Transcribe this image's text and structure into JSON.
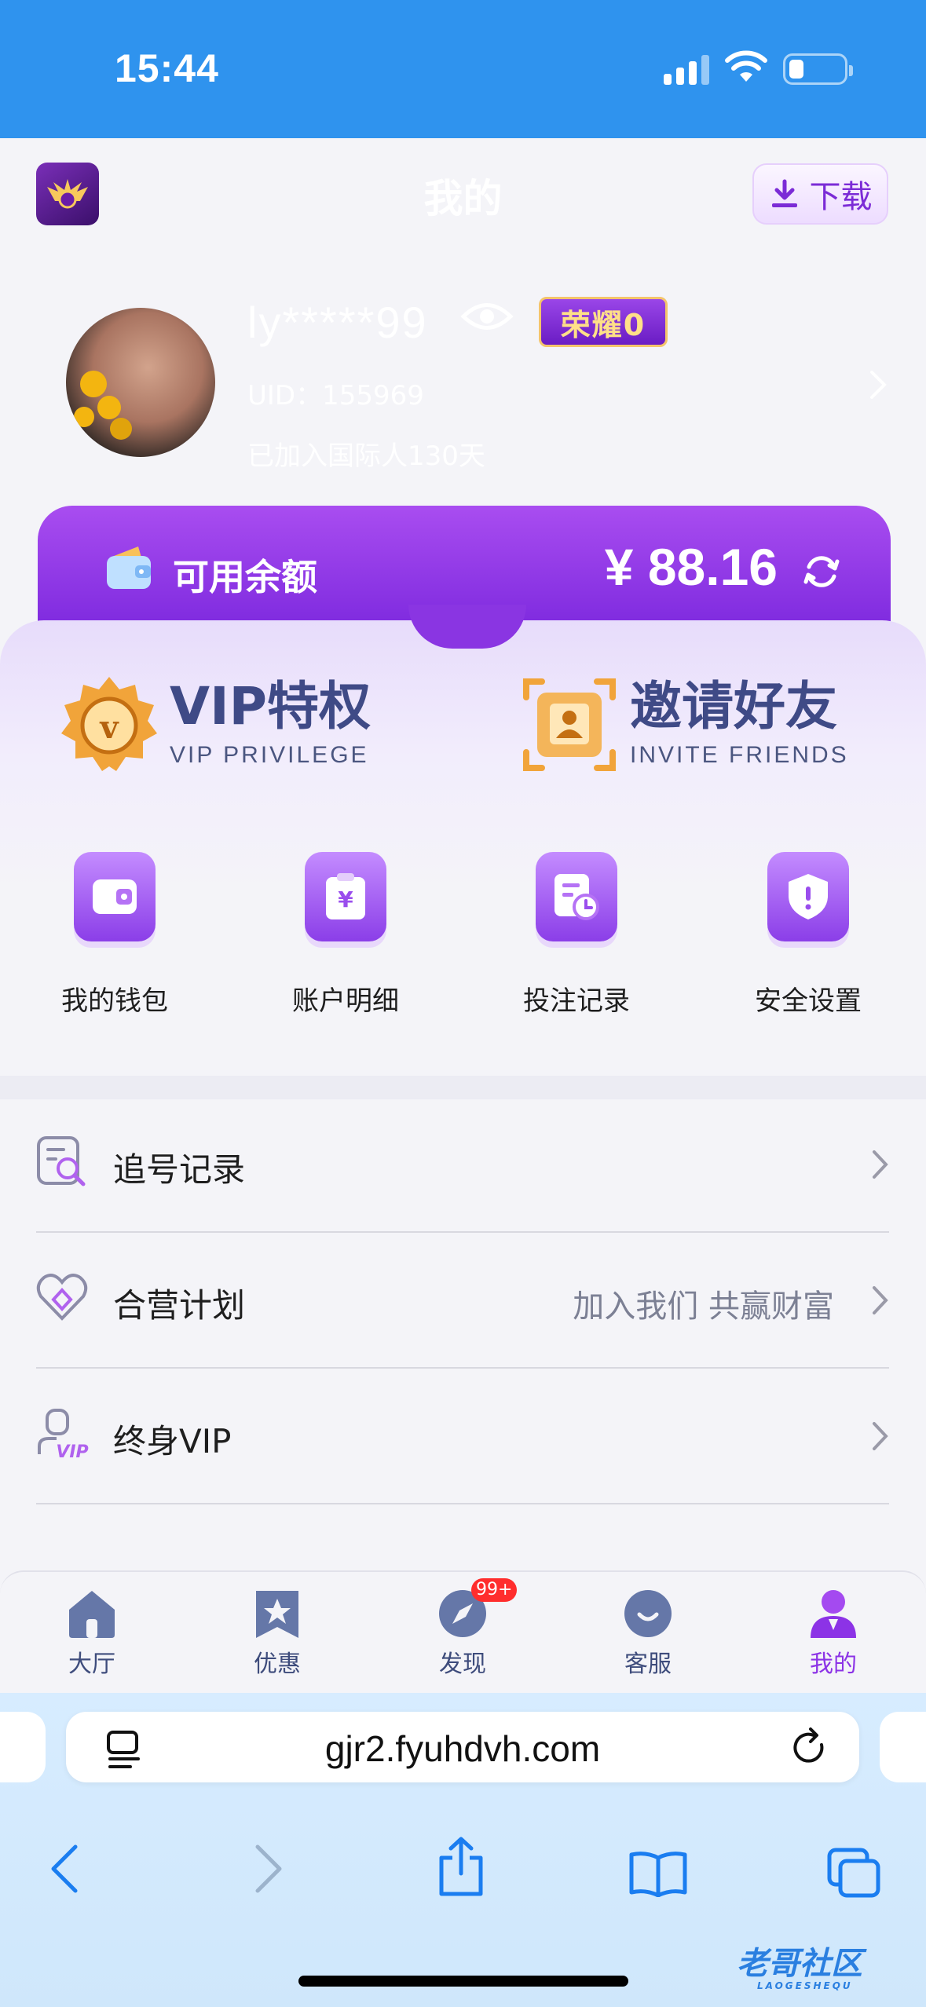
{
  "status": {
    "time": "15:44"
  },
  "header": {
    "title": "我的",
    "download_label": "下载"
  },
  "profile": {
    "username": "ly*****99",
    "honor_badge": "荣耀0",
    "uid": "UID：155969",
    "joined": "已加入国际人130天"
  },
  "balance": {
    "label": "可用余额",
    "value": "¥ 88.16"
  },
  "features": [
    {
      "title": "VIP特权",
      "subtitle": "VIP PRIVILEGE",
      "icon": "vip-medal-icon"
    },
    {
      "title": "邀请好友",
      "subtitle": "INVITE FRIENDS",
      "icon": "invite-card-icon"
    }
  ],
  "shortcuts": [
    {
      "label": "我的钱包",
      "icon": "wallet-icon"
    },
    {
      "label": "账户明细",
      "icon": "yuan-clipboard-icon"
    },
    {
      "label": "投注记录",
      "icon": "record-clock-icon"
    },
    {
      "label": "安全设置",
      "icon": "shield-icon"
    }
  ],
  "menu": [
    {
      "label": "追号记录",
      "extra": "",
      "icon": "search-document-icon"
    },
    {
      "label": "合营计划",
      "extra": "加入我们 共赢财富",
      "icon": "heart-diamond-icon"
    },
    {
      "label": "终身VIP",
      "extra": "",
      "icon": "vip-person-icon"
    }
  ],
  "bottom_nav": [
    {
      "label": "大厅",
      "icon": "home-icon"
    },
    {
      "label": "优惠",
      "icon": "star-bookmark-icon"
    },
    {
      "label": "发现",
      "icon": "compass-icon",
      "badge": "99+"
    },
    {
      "label": "客服",
      "icon": "smile-icon"
    },
    {
      "label": "我的",
      "icon": "user-icon",
      "active": true
    }
  ],
  "browser": {
    "url": "gjr2.fyuhdvh.com"
  },
  "watermark": {
    "text": "老哥社区",
    "sub": "LAOGESHEQU"
  },
  "colors": {
    "accent": "#8c33e6",
    "status_bar": "#2f93ee",
    "nav_text": "#3e4c7c"
  }
}
